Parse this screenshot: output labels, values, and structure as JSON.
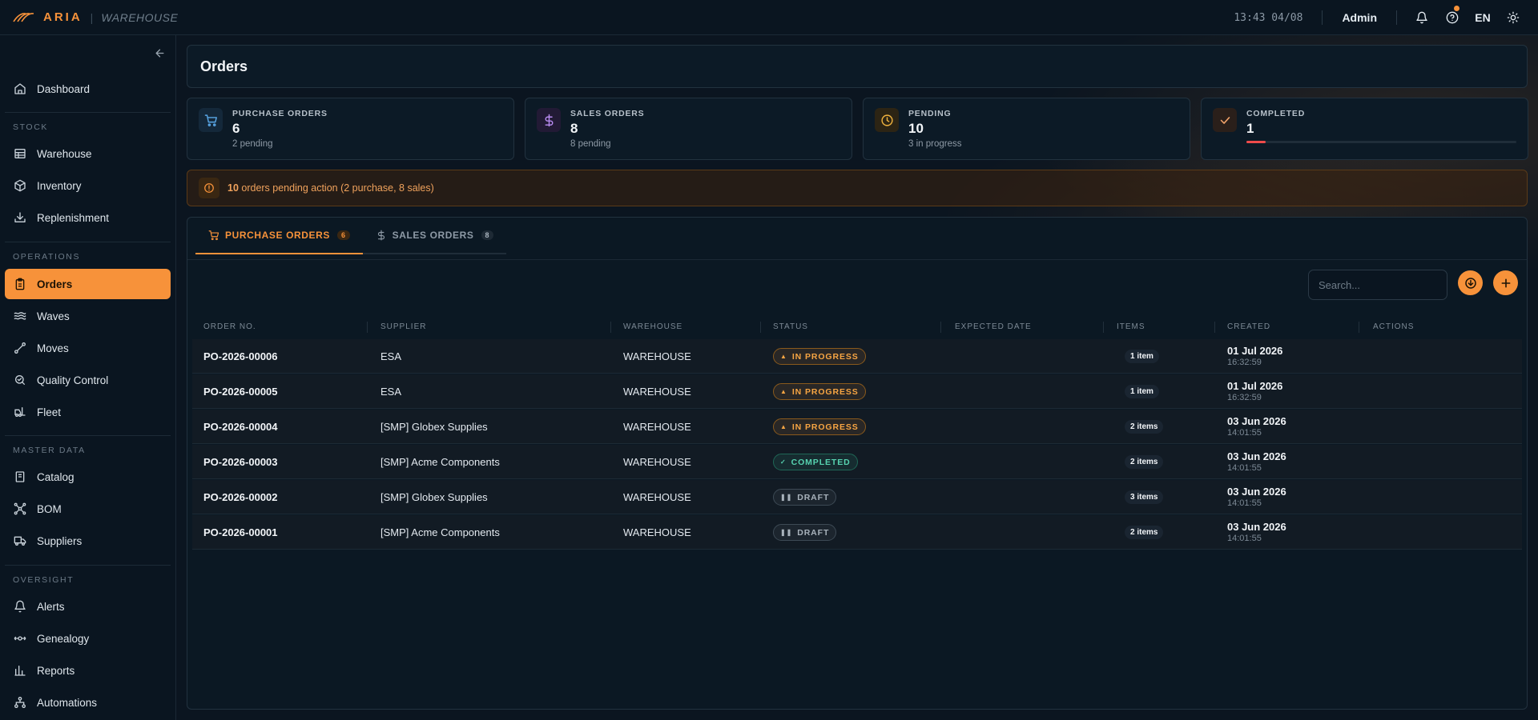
{
  "brand": {
    "name": "ARIA",
    "sub": "WAREHOUSE",
    "accent": "#f7923a"
  },
  "topbar": {
    "clock": "13:43 04/08",
    "user": "Admin",
    "language": "EN",
    "icons": [
      "bell-icon",
      "help-icon",
      "theme-icon"
    ]
  },
  "sidebar": {
    "dashboard": "Dashboard",
    "sections": {
      "stock": "STOCK",
      "operations": "OPERATIONS",
      "master": "MASTER DATA",
      "oversight": "OVERSIGHT"
    },
    "items": {
      "warehouse": "Warehouse",
      "inventory": "Inventory",
      "replenishment": "Replenishment",
      "orders": "Orders",
      "waves": "Waves",
      "moves": "Moves",
      "quality": "Quality Control",
      "fleet": "Fleet",
      "catalog": "Catalog",
      "bom": "BOM",
      "suppliers": "Suppliers",
      "alerts": "Alerts",
      "genealogy": "Genealogy",
      "reports": "Reports",
      "automations": "Automations"
    }
  },
  "page": {
    "title": "Orders"
  },
  "stats": [
    {
      "label": "PURCHASE ORDERS",
      "value": "6",
      "sub": "2 pending",
      "icon": "cart-icon"
    },
    {
      "label": "SALES ORDERS",
      "value": "8",
      "sub": "8 pending",
      "icon": "dollar-icon"
    },
    {
      "label": "PENDING",
      "value": "10",
      "sub": "3 in progress",
      "icon": "clock-icon"
    },
    {
      "label": "COMPLETED",
      "value": "1",
      "progress": 0.07,
      "icon": "check-icon"
    }
  ],
  "alert": {
    "count": "10",
    "text": " orders pending action (2 purchase, 8 sales)"
  },
  "tabs": [
    {
      "label": "PURCHASE ORDERS",
      "count": "6"
    },
    {
      "label": "SALES ORDERS",
      "count": "8"
    }
  ],
  "search": {
    "placeholder": "Search..."
  },
  "table": {
    "columns": [
      "ORDER NO.",
      "SUPPLIER",
      "WAREHOUSE",
      "STATUS",
      "EXPECTED DATE",
      "ITEMS",
      "CREATED",
      "ACTIONS"
    ],
    "rows": [
      {
        "order": "PO-2026-00006",
        "supplier": "ESA",
        "warehouse": "WAREHOUSE",
        "status": "IN PROGRESS",
        "expected": "",
        "items": "1 item",
        "created_date": "01 Jul 2026",
        "created_time": "16:32:59"
      },
      {
        "order": "PO-2026-00005",
        "supplier": "ESA",
        "warehouse": "WAREHOUSE",
        "status": "IN PROGRESS",
        "expected": "",
        "items": "1 item",
        "created_date": "01 Jul 2026",
        "created_time": "16:32:59"
      },
      {
        "order": "PO-2026-00004",
        "supplier": "[SMP] Globex Supplies",
        "warehouse": "WAREHOUSE",
        "status": "IN PROGRESS",
        "expected": "",
        "items": "2 items",
        "created_date": "03 Jun 2026",
        "created_time": "14:01:55"
      },
      {
        "order": "PO-2026-00003",
        "supplier": "[SMP] Acme Components",
        "warehouse": "WAREHOUSE",
        "status": "COMPLETED",
        "expected": "",
        "items": "2 items",
        "created_date": "03 Jun 2026",
        "created_time": "14:01:55"
      },
      {
        "order": "PO-2026-00002",
        "supplier": "[SMP] Globex Supplies",
        "warehouse": "WAREHOUSE",
        "status": "DRAFT",
        "expected": "",
        "items": "3 items",
        "created_date": "03 Jun 2026",
        "created_time": "14:01:55"
      },
      {
        "order": "PO-2026-00001",
        "supplier": "[SMP] Acme Components",
        "warehouse": "WAREHOUSE",
        "status": "DRAFT",
        "expected": "",
        "items": "2 items",
        "created_date": "03 Jun 2026",
        "created_time": "14:01:55"
      }
    ]
  }
}
